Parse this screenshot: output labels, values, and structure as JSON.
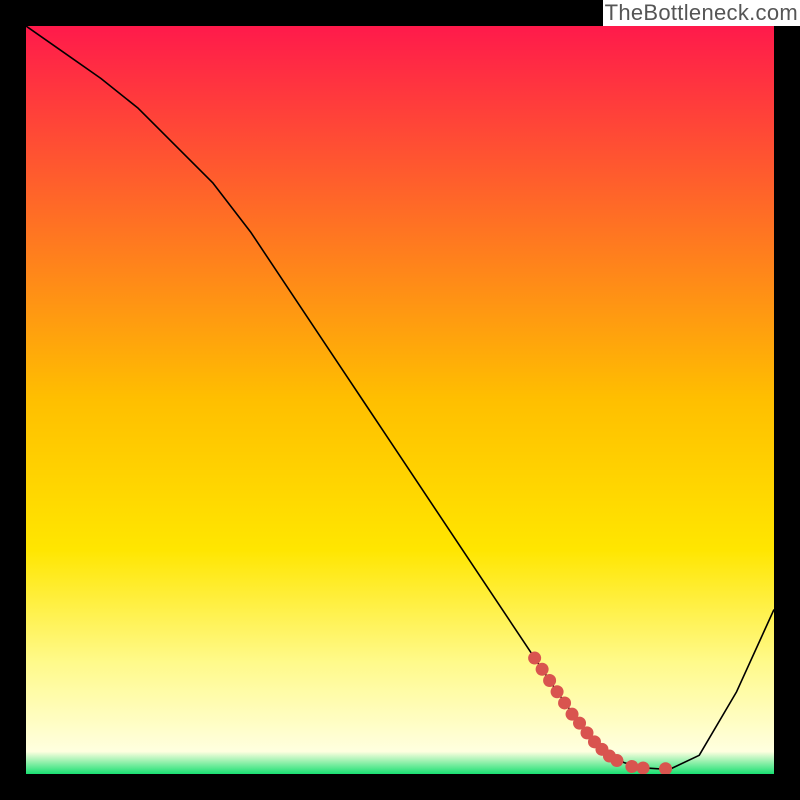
{
  "watermark": "TheBottleneck.com",
  "chart_data": {
    "type": "line",
    "title": "",
    "xlabel": "",
    "ylabel": "",
    "xlim": [
      0,
      100
    ],
    "ylim": [
      0,
      100
    ],
    "grid": false,
    "legend": false,
    "background": {
      "type": "vertical-gradient",
      "stops": [
        {
          "offset": 0.0,
          "color": "#ff1a4b"
        },
        {
          "offset": 0.5,
          "color": "#ffbf00"
        },
        {
          "offset": 0.7,
          "color": "#ffe600"
        },
        {
          "offset": 0.85,
          "color": "#fffa8a"
        },
        {
          "offset": 0.97,
          "color": "#ffffe0"
        },
        {
          "offset": 1.0,
          "color": "#19e072"
        }
      ]
    },
    "series": [
      {
        "name": "curve",
        "color": "#000000",
        "width": 1.6,
        "x": [
          0,
          5,
          10,
          15,
          20,
          25,
          30,
          35,
          40,
          45,
          50,
          55,
          60,
          65,
          71,
          76,
          80,
          83,
          86,
          90,
          95,
          100
        ],
        "y": [
          100,
          96.5,
          93,
          89,
          84,
          79,
          72.5,
          65,
          57.5,
          50,
          42.5,
          35,
          27.5,
          20,
          11,
          4,
          1.5,
          0.8,
          0.6,
          2.5,
          11,
          22
        ]
      },
      {
        "name": "highlight-dots",
        "color": "#d9544f",
        "type": "scatter",
        "marker_size": 9,
        "x": [
          68,
          69,
          70,
          71,
          72,
          73,
          74,
          75,
          76,
          77,
          78,
          79,
          81,
          82.5,
          85.5
        ],
        "y": [
          15.5,
          14,
          12.5,
          11,
          9.5,
          8,
          6.8,
          5.5,
          4.3,
          3.3,
          2.4,
          1.8,
          1.0,
          0.8,
          0.7
        ]
      }
    ],
    "border_color": "#000000",
    "border_width": 26
  }
}
